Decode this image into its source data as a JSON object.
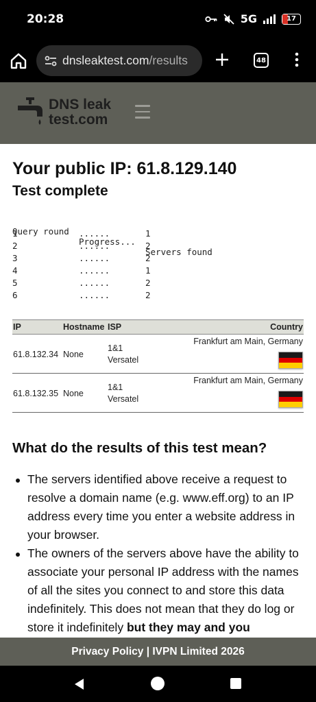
{
  "status_bar": {
    "time": "20:28",
    "network": "5G",
    "battery": "17"
  },
  "browser": {
    "url_host": "dnsleaktest.com",
    "url_path": "/results",
    "tab_count": "48"
  },
  "site": {
    "logo_line1": "DNS leak",
    "logo_line2": "test.com"
  },
  "page": {
    "ip_title": "Your public IP: 61.8.129.140",
    "status": "Test complete",
    "rounds_header": [
      "Query round",
      "Progress...",
      "Servers found"
    ],
    "rounds": [
      {
        "round": "1",
        "progress": "......",
        "servers": "1"
      },
      {
        "round": "2",
        "progress": "......",
        "servers": "2"
      },
      {
        "round": "3",
        "progress": "......",
        "servers": "2"
      },
      {
        "round": "4",
        "progress": "......",
        "servers": "1"
      },
      {
        "round": "5",
        "progress": "......",
        "servers": "2"
      },
      {
        "round": "6",
        "progress": "......",
        "servers": "2"
      }
    ],
    "table_headers": {
      "ip": "IP",
      "hostname": "Hostname",
      "isp": "ISP",
      "country": "Country"
    },
    "servers": [
      {
        "ip": "61.8.132.34",
        "hostname": "None",
        "isp_line1": "1&1",
        "isp_line2": "Versatel",
        "country": "Frankfurt am Main, Germany",
        "flag": "germany-flag"
      },
      {
        "ip": "61.8.132.35",
        "hostname": "None",
        "isp_line1": "1&1",
        "isp_line2": "Versatel",
        "country": "Frankfurt am Main, Germany",
        "flag": "germany-flag"
      }
    ],
    "section_title": "What do the results of this test mean?",
    "bullet1": "The servers identified above receive a request to resolve a domain name (e.g. www.eff.org) to an IP address every time you enter a website address in your browser.",
    "bullet2_text": "The owners of the servers above have the ability to associate your personal IP address with the names of all the sites you connect to and store this data indefinitely. This does not mean that they do log or store it indefinitely ",
    "bullet2_bold": "but they may and you"
  },
  "footer": {
    "text": "Privacy Policy | IVPN Limited 2026"
  }
}
